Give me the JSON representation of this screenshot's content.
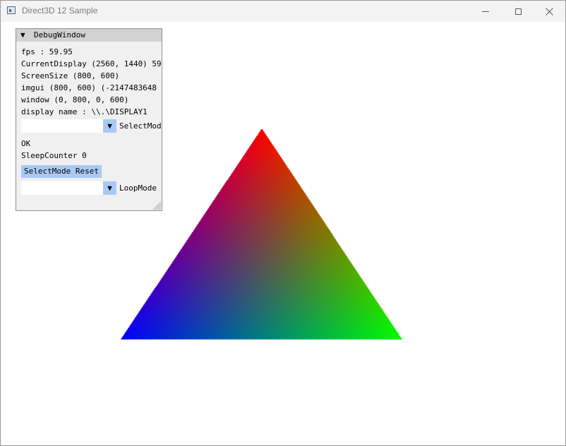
{
  "window": {
    "title": "Direct3D 12 Sample"
  },
  "scene": {
    "triangle_colors": {
      "top": "#ff0000",
      "left": "#0000ff",
      "right": "#00ff00"
    },
    "background": "#ffffff"
  },
  "debug_window": {
    "title": "DebugWindow",
    "collapse_icon": "▼",
    "lines": {
      "fps": "fps :  59.95",
      "current_display": "CurrentDisplay (2560, 1440) 59",
      "screen_size": "ScreenSize (800, 600)",
      "imgui": "imgui (800, 600) (-2147483648",
      "window_rect": "window (0, 800, 0, 600)",
      "display_name": "display name : \\\\.\\DISPLAY1",
      "status": "OK",
      "sleep_counter": "SleepCounter 0"
    },
    "select_mode_combo": {
      "value": "",
      "arrow": "▼",
      "label": "SelectMode"
    },
    "reset_button_label": "SelectMode Reset",
    "loop_mode_combo": {
      "value": "",
      "arrow": "▼",
      "label": "LoopMode"
    }
  }
}
